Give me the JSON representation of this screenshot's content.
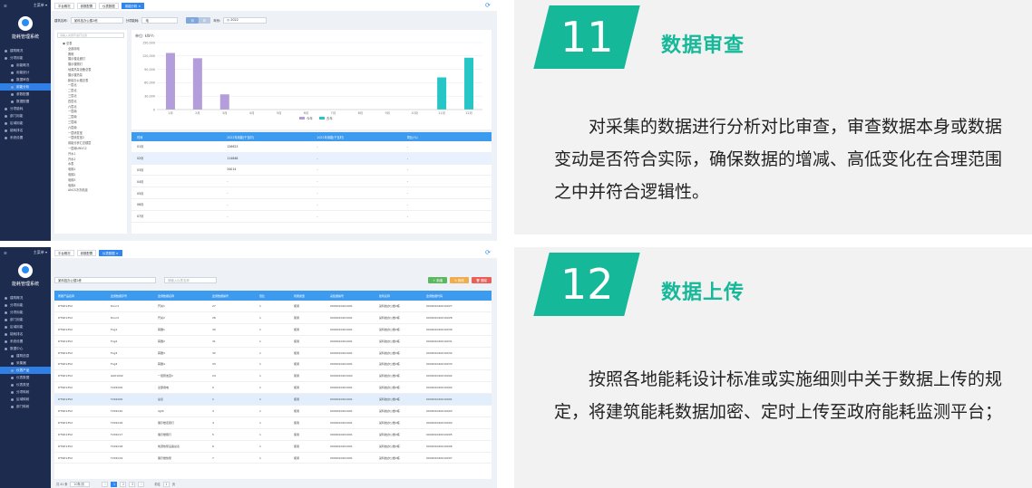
{
  "sidebar": {
    "menu_label": "主菜单 ▾",
    "system_name": "能耗管理系统",
    "items_top": [
      "建筑概况",
      "分项用能",
      "用能概况",
      "用能统计",
      "数据审查",
      "用能分析",
      "参数配置",
      "数据配置",
      "分项能耗",
      "部门用能",
      "区域用能",
      "能耗排名",
      "系统设置"
    ],
    "items_bottom": [
      "建筑概况",
      "分项用能",
      "分项用能",
      "部门用能",
      "区域用能",
      "能耗排名",
      "系统设置",
      "数据中心",
      "建筑信息",
      "采集器",
      "仪表产品",
      "仪表数据",
      "仪表类型",
      "分项映射",
      "区域映射",
      "部门映射"
    ]
  },
  "shot1": {
    "tabs": [
      "平台概况",
      "参数配置",
      "仪表数据",
      "用能分析 ×"
    ],
    "filter": {
      "building_label": "建筑名称:",
      "building_value": "某科技办公楼2栋",
      "type_label": "分项能耗:",
      "type_value": "电",
      "btn_month": "月",
      "btn_year": "年",
      "year_label": "年份:",
      "year_value": "2022"
    },
    "tree_search": "请输入关键字进行过滤",
    "tree_items": [
      "总表",
      "全部用电",
      "照明",
      "展示楼走廊灯",
      "展示楼照灯",
      "地源热泵设备总表",
      "展示楼热泵",
      "新增办公楼总表",
      "一层北",
      "二层北",
      "三层北",
      "四层北",
      "六层北",
      "一层南",
      "二层南",
      "三层南",
      "六层南",
      "一层研发室",
      "一层研发室2",
      "用能分析汇总楼层",
      "一层南UNVC2",
      "开水1",
      "开水2",
      "水表",
      "电梯1",
      "电梯2",
      "电梯3",
      "电梯4",
      "ANCS冷冻机组"
    ],
    "table_headers": [
      "时间",
      "2022年用能(千瓦时)",
      "2021年用能(千瓦时)",
      "同比(%)"
    ],
    "table_rows": [
      [
        "01月",
        "126623",
        "-",
        "-"
      ],
      [
        "02月",
        "114848",
        "-",
        "-"
      ],
      [
        "03月",
        "34014",
        "-",
        "-"
      ],
      [
        "04月",
        "-",
        "-",
        "-"
      ],
      [
        "05月",
        "-",
        "-",
        "-"
      ],
      [
        "06月",
        "-",
        "-",
        "-"
      ],
      [
        "07月",
        "-",
        "-",
        "-"
      ]
    ]
  },
  "chart_data": {
    "type": "bar",
    "ylabel": "单位: kW·h",
    "ylim": [
      0,
      150000
    ],
    "y_ticks": [
      "0",
      "30,000",
      "60,000",
      "90,000",
      "120,000",
      "150,000"
    ],
    "categories": [
      "1月",
      "2月",
      "3月",
      "4月",
      "5月",
      "6月",
      "7月",
      "8月",
      "9月",
      "10月",
      "11月",
      "12月"
    ],
    "series": [
      {
        "name": "今年",
        "values": [
          126623,
          114848,
          34014,
          0,
          0,
          0,
          0,
          0,
          0,
          0,
          0,
          0
        ]
      },
      {
        "name": "去年",
        "values": [
          0,
          0,
          0,
          0,
          0,
          0,
          0,
          0,
          0,
          0,
          72000,
          116000
        ]
      }
    ],
    "legend": "bottom-center",
    "grid": true
  },
  "shot2": {
    "tabs": [
      "平台概况",
      "参数配置",
      "仪表数据 ×"
    ],
    "building_value": "某科技办公楼2栋",
    "search_placeholder": "请输入仪表名称",
    "btn_add": "+ 新增",
    "btn_edit": "✎ 修改",
    "btn_delete": "🗑 删除",
    "table_headers": [
      "所属产品名称",
      "监测数据序号",
      "监测数据名称",
      "监测数据编号",
      "倍比",
      "所属类型",
      "采集器编号",
      "建筑名称",
      "监测数据代码"
    ],
    "table_rows": [
      [
        "DTSD1352",
        "Door1",
        "开关1",
        "27",
        "1",
        "使用",
        "0000010201001",
        "某科技办公楼2栋",
        "000001020010027"
      ],
      [
        "DTSD1352",
        "Door2",
        "开关2",
        "28",
        "1",
        "使用",
        "0000010201001",
        "某科技办公楼2栋",
        "000001020010028"
      ],
      [
        "DTSD1352",
        "Fog1",
        "雾器1",
        "30",
        "1",
        "使用",
        "0000010201001",
        "某科技办公楼2栋",
        "000001020010030"
      ],
      [
        "DTSD1352",
        "Fog2",
        "雾器2",
        "31",
        "1",
        "使用",
        "0000010201001",
        "某科技办公楼2栋",
        "000001020010031"
      ],
      [
        "DTSD1352",
        "Fog3",
        "雾器3",
        "32",
        "1",
        "使用",
        "0000010201001",
        "某科技办公楼2栋",
        "000001020010032"
      ],
      [
        "DTSD1352",
        "Fog4",
        "雾器4",
        "33",
        "1",
        "使用",
        "0000010201001",
        "某科技办公楼2栋",
        "000001020010033"
      ],
      [
        "DTSD1352",
        "G001002",
        "一层研发室2",
        "24",
        "1",
        "使用",
        "0000010201002",
        "某科技办公楼2栋",
        "000001020010002"
      ],
      [
        "DTSD1352",
        "T201000",
        "全部用电",
        "2",
        "1",
        "使用",
        "0000010201001",
        "某科技办公楼2栋",
        "000001020010002"
      ],
      [
        "DTSD1352",
        "T201000",
        "总表",
        "1",
        "1",
        "使用",
        "0000010201001",
        "某科技办公楼2栋",
        "000001020010001"
      ],
      [
        "DTSD1352",
        "T201010",
        "light",
        "3",
        "1",
        "使用",
        "0000010201001",
        "某科技办公楼2栋",
        "000001020010003"
      ],
      [
        "DTSD1352",
        "T201016",
        "展示楼走廊灯",
        "4",
        "1",
        "使用",
        "0000010201001",
        "某科技办公楼2栋",
        "000001020010004"
      ],
      [
        "DTSD1352",
        "T201017",
        "展示楼照灯",
        "5",
        "1",
        "使用",
        "0000010201001",
        "某科技办公楼2栋",
        "000001020010005"
      ],
      [
        "DTSD1352",
        "T201018",
        "地源热泵设备总表",
        "6",
        "1",
        "使用",
        "0000010201001",
        "某科技办公楼2栋",
        "000001020010006"
      ],
      [
        "DTSD1352",
        "T201019",
        "展示楼热泵",
        "7",
        "1",
        "使用",
        "0000010201001",
        "某科技办公楼2栋",
        "000001020010007"
      ]
    ],
    "pager": {
      "total": "共 41 条",
      "size": "20条/页",
      "pages": [
        "1",
        "2",
        "3"
      ],
      "goto": "前往",
      "goto_value": "1",
      "page_unit": "页"
    }
  },
  "card1": {
    "number": "11",
    "title": "数据审查",
    "body": "对采集的数据进行分析对比审查，审查数据本身或数据变动是否符合实际，确保数据的增减、高低变化在合理范围之中并符合逻辑性。"
  },
  "card2": {
    "number": "12",
    "title": "数据上传",
    "body": "按照各地能耗设计标准或实施细则中关于数据上传的规定，将建筑能耗数据加密、定时上传至政府能耗监测平台；"
  },
  "colors": {
    "accent": "#15b898",
    "bar_this_year": "#b39ddb",
    "bar_last_year": "#26c6c6",
    "sidebar": "#1d2b4f",
    "table_header": "#3d9bef"
  }
}
